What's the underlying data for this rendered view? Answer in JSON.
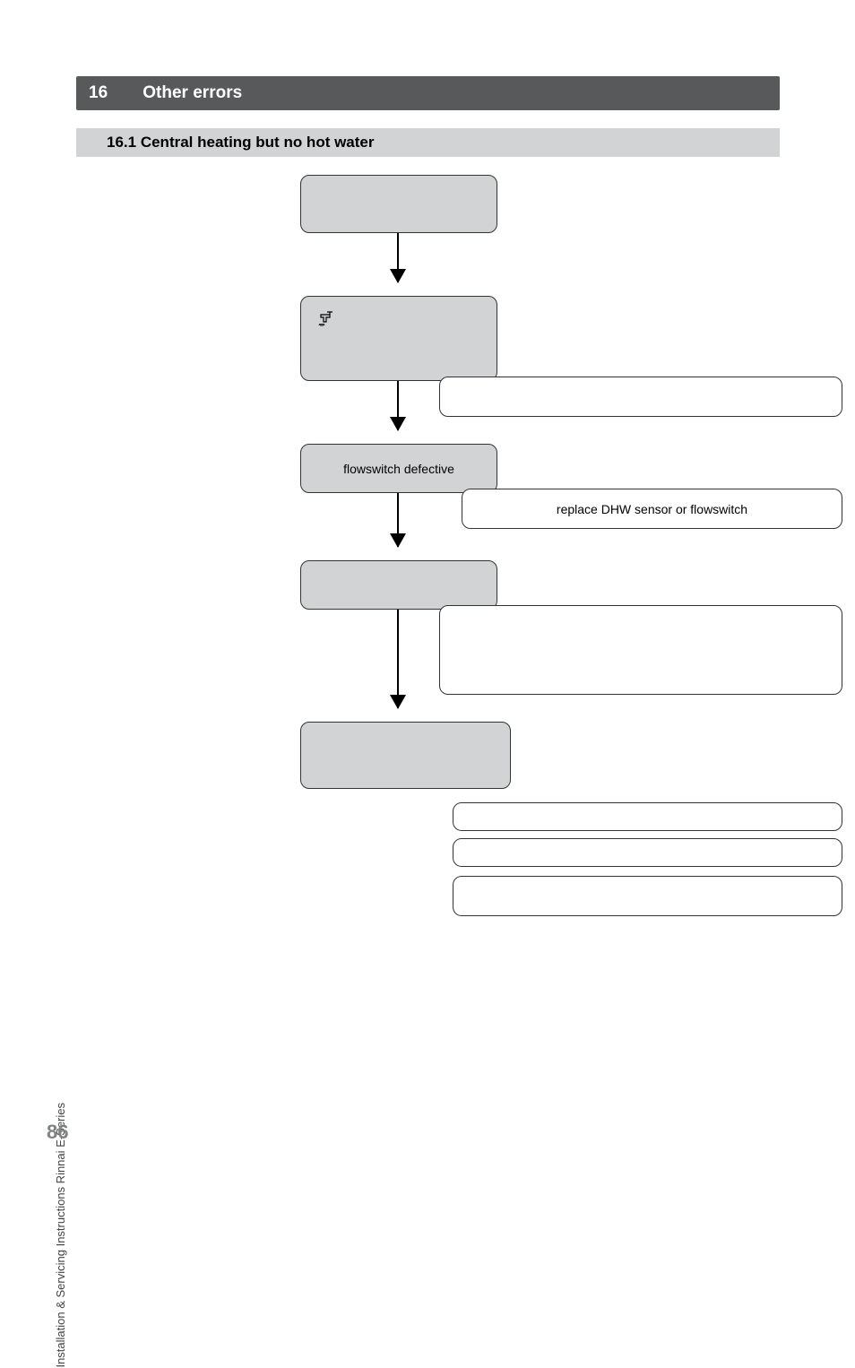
{
  "chapter": {
    "num": "16",
    "title": "Other errors"
  },
  "section": {
    "num": "16.1",
    "title": "Central heating but no hot water"
  },
  "flow": {
    "box1": "",
    "box2": "",
    "box2_side": "",
    "box3": "flowswitch defective",
    "box3_side": "replace DHW sensor or flowswitch",
    "box4": "",
    "box4_side": "",
    "box5": "",
    "box5_side1": "",
    "box5_side2": "",
    "box5_side3": ""
  },
  "footer": {
    "side_label": "Installation & Servicing Instructions Rinnai E-Series",
    "page": "86"
  },
  "chart_data": {
    "type": "flowchart",
    "title": "16.1 Central heating but no hot water",
    "nodes": [
      {
        "id": "n1",
        "label": "",
        "style": "shaded"
      },
      {
        "id": "n2",
        "label": "",
        "style": "shaded",
        "icon": "tap-on"
      },
      {
        "id": "n2side",
        "label": "",
        "style": "white"
      },
      {
        "id": "n3",
        "label": "flowswitch defective",
        "style": "shaded"
      },
      {
        "id": "n3side",
        "label": "replace DHW sensor or flowswitch",
        "style": "white"
      },
      {
        "id": "n4",
        "label": "",
        "style": "shaded"
      },
      {
        "id": "n4side",
        "label": "",
        "style": "white"
      },
      {
        "id": "n5",
        "label": "",
        "style": "shaded"
      },
      {
        "id": "n5side1",
        "label": "",
        "style": "white"
      },
      {
        "id": "n5side2",
        "label": "",
        "style": "white"
      },
      {
        "id": "n5side3",
        "label": "",
        "style": "white"
      }
    ],
    "edges": [
      {
        "from": "n1",
        "to": "n2",
        "arrow": true
      },
      {
        "from": "n2",
        "to": "n3",
        "arrow": true
      },
      {
        "from": "n3",
        "to": "n4",
        "arrow": true
      },
      {
        "from": "n4",
        "to": "n5",
        "arrow": true
      },
      {
        "from": "n2",
        "to": "n2side",
        "arrow": false
      },
      {
        "from": "n3",
        "to": "n3side",
        "arrow": false
      },
      {
        "from": "n4",
        "to": "n4side",
        "arrow": false
      },
      {
        "from": "n5",
        "to": "n5side1",
        "arrow": false
      },
      {
        "from": "n5",
        "to": "n5side2",
        "arrow": false
      },
      {
        "from": "n5",
        "to": "n5side3",
        "arrow": false
      }
    ]
  }
}
